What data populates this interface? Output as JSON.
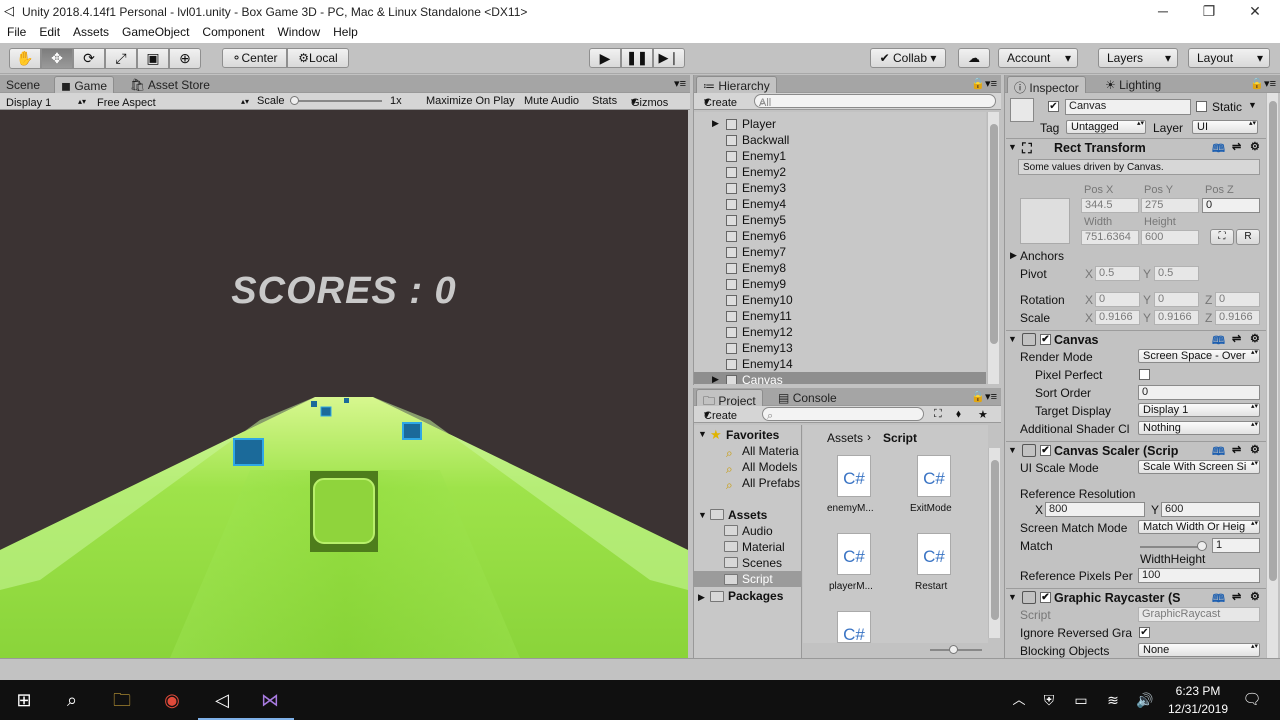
{
  "window": {
    "title": "Unity 2018.4.14f1 Personal - lvl01.unity - Box Game 3D - PC, Mac & Linux Standalone <DX11>"
  },
  "menu": [
    "File",
    "Edit",
    "Assets",
    "GameObject",
    "Component",
    "Window",
    "Help"
  ],
  "toolbar": {
    "pivot_center": "Center",
    "pivot_local": "Local",
    "collab": "Collab",
    "account": "Account",
    "layers": "Layers",
    "layout": "Layout"
  },
  "game_panel": {
    "tabs": [
      "Scene",
      "Game",
      "Asset Store"
    ],
    "display": "Display 1",
    "aspect": "Free Aspect",
    "scale_label": "Scale",
    "scale_value": "1x",
    "maximize": "Maximize On Play",
    "mute": "Mute Audio",
    "stats": "Stats",
    "gizmos": "Gizmos",
    "score_text": "SCORES : 0"
  },
  "hierarchy": {
    "tab": "Hierarchy",
    "create": "Create",
    "search_placeholder": "All",
    "items": [
      "Player",
      "Backwall",
      "Enemy1",
      "Enemy2",
      "Enemy3",
      "Enemy4",
      "Enemy5",
      "Enemy6",
      "Enemy7",
      "Enemy8",
      "Enemy9",
      "Enemy10",
      "Enemy11",
      "Enemy12",
      "Enemy13",
      "Enemy14",
      "Canvas"
    ],
    "selected": "Canvas"
  },
  "project": {
    "tabs": [
      "Project",
      "Console"
    ],
    "create": "Create",
    "favorites_label": "Favorites",
    "favorites": [
      "All Materia",
      "All Models",
      "All Prefabs"
    ],
    "assets_label": "Assets",
    "asset_folders": [
      "Audio",
      "Material",
      "Scenes",
      "Script"
    ],
    "packages_label": "Packages",
    "breadcrumb": [
      "Assets",
      "Script"
    ],
    "files": [
      {
        "name": "enemyM...",
        "glyph": "C#"
      },
      {
        "name": "ExitMode",
        "glyph": "C#"
      },
      {
        "name": "playerM...",
        "glyph": "C#"
      },
      {
        "name": "Restart",
        "glyph": "C#"
      },
      {
        "name": "",
        "glyph": "C#"
      }
    ]
  },
  "inspector": {
    "tabs": [
      "Inspector",
      "Lighting"
    ],
    "object_name": "Canvas",
    "static_label": "Static",
    "tag_label": "Tag",
    "tag_value": "Untagged",
    "layer_label": "Layer",
    "layer_value": "UI",
    "rect_transform": {
      "title": "Rect Transform",
      "note": "Some values driven by Canvas.",
      "pos_x_label": "Pos X",
      "pos_y_label": "Pos Y",
      "pos_z_label": "Pos Z",
      "pos_x": "344.5",
      "pos_y": "275",
      "pos_z": "0",
      "width_label": "Width",
      "height_label": "Height",
      "width": "751.6364",
      "height": "600",
      "r_button": "R",
      "anchors": "Anchors",
      "pivot": "Pivot",
      "pivot_x": "0.5",
      "pivot_y": "0.5",
      "rotation": "Rotation",
      "rot_x": "0",
      "rot_y": "0",
      "rot_z": "0",
      "scale": "Scale",
      "scale_x": "0.9166",
      "scale_y": "0.9166",
      "scale_z": "0.9166",
      "x": "X",
      "y": "Y",
      "z": "Z"
    },
    "canvas": {
      "title": "Canvas",
      "render_mode_label": "Render Mode",
      "render_mode": "Screen Space - Over",
      "pixel_perfect": "Pixel Perfect",
      "sort_order_label": "Sort Order",
      "sort_order": "0",
      "target_display_label": "Target Display",
      "target_display": "Display 1",
      "shader_label": "Additional Shader Cl",
      "shader": "Nothing"
    },
    "canvas_scaler": {
      "title": "Canvas Scaler (Scrip",
      "ui_scale_label": "UI Scale Mode",
      "ui_scale": "Scale With Screen Si",
      "ref_res_label": "Reference Resolution",
      "ref_x": "800",
      "ref_y": "600",
      "match_mode_label": "Screen Match Mode",
      "match_mode": "Match Width Or Heig",
      "match_label": "Match",
      "match_value": "1",
      "match_caption": "WidthHeight",
      "ref_pixels_label": "Reference Pixels Per",
      "ref_pixels": "100"
    },
    "raycaster": {
      "title": "Graphic Raycaster (S",
      "script_label": "Script",
      "script": "GraphicRaycast",
      "ignore_label": "Ignore Reversed Gra",
      "blocking_label": "Blocking Objects",
      "blocking": "None"
    }
  },
  "taskbar": {
    "time": "6:23 PM",
    "date": "12/31/2019"
  }
}
